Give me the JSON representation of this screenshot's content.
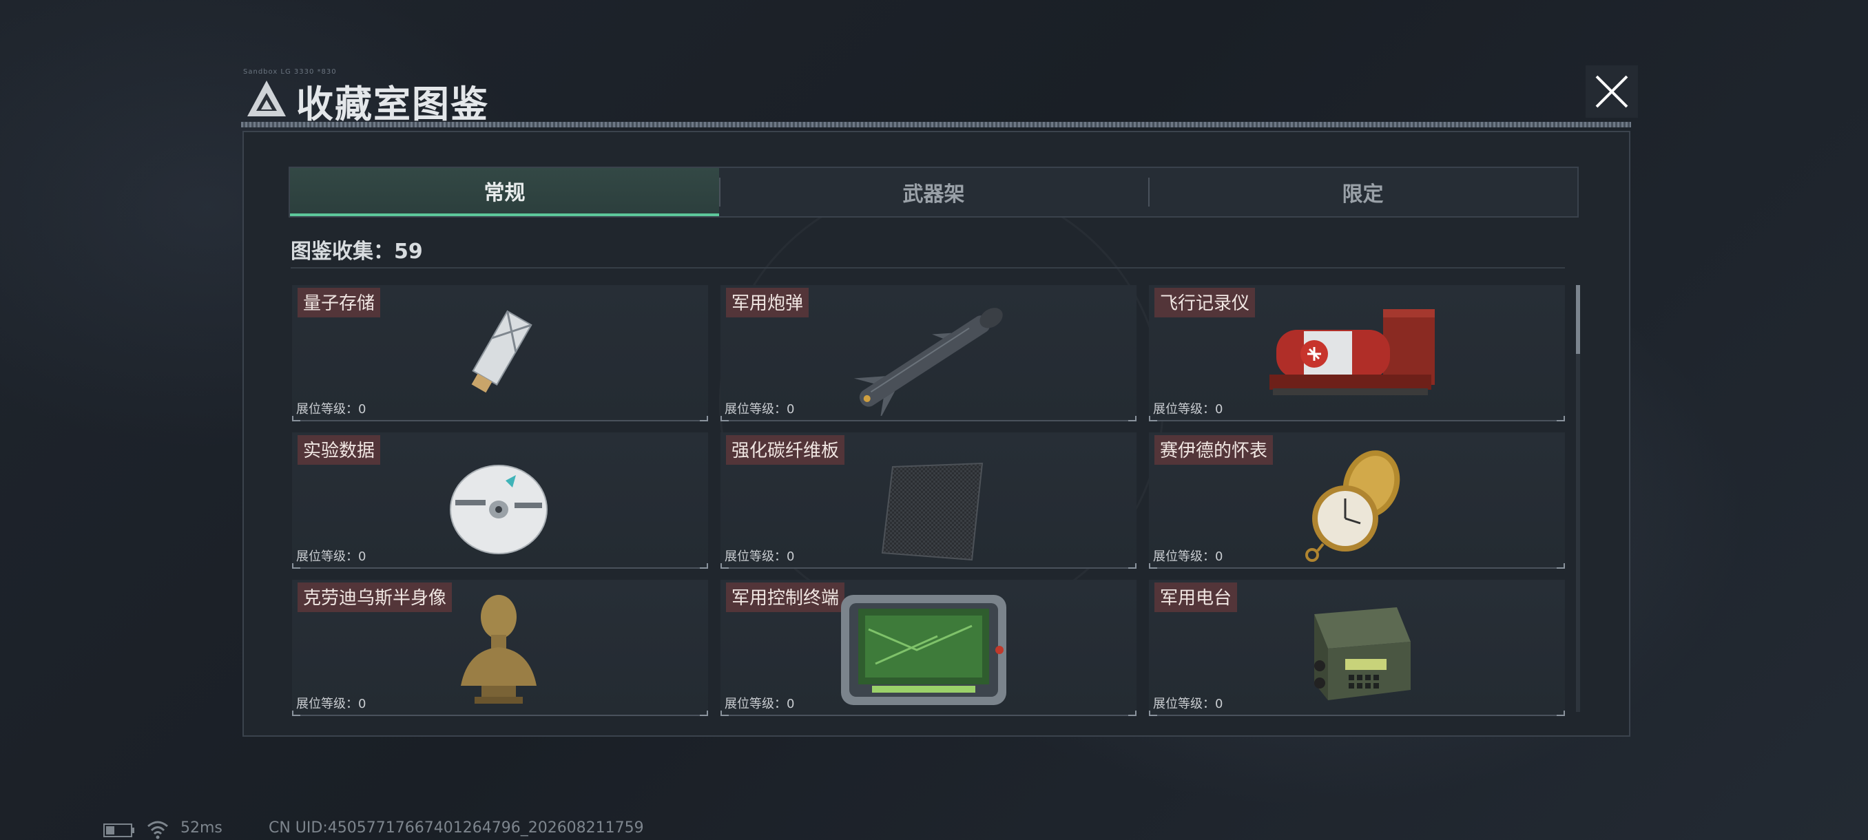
{
  "header": {
    "tiny_caption": "Sandbox LG 3330 *830",
    "title": "收藏室图鉴"
  },
  "tabs": [
    {
      "label": "常规",
      "active": true
    },
    {
      "label": "武器架",
      "active": false
    },
    {
      "label": "限定",
      "active": false
    }
  ],
  "collection": {
    "label": "图鉴收集：59"
  },
  "items": [
    {
      "name": "量子存储",
      "level": "展位等级：0",
      "icon": "usb-drive-icon"
    },
    {
      "name": "军用炮弹",
      "level": "展位等级：0",
      "icon": "missile-icon"
    },
    {
      "name": "飞行记录仪",
      "level": "展位等级：0",
      "icon": "flight-recorder-icon"
    },
    {
      "name": "实验数据",
      "level": "展位等级：0",
      "icon": "disc-icon"
    },
    {
      "name": "强化碳纤维板",
      "level": "展位等级：0",
      "icon": "carbon-plate-icon"
    },
    {
      "name": "赛伊德的怀表",
      "level": "展位等级：0",
      "icon": "pocket-watch-icon"
    },
    {
      "name": "克劳迪乌斯半身像",
      "level": "展位等级：0",
      "icon": "bust-icon"
    },
    {
      "name": "军用控制终端",
      "level": "展位等级：0",
      "icon": "terminal-icon"
    },
    {
      "name": "军用电台",
      "level": "展位等级：0",
      "icon": "radio-icon"
    }
  ],
  "status_bar": {
    "ping": "52ms",
    "uid": "CN UID:450577176674012647​96_202608211759"
  },
  "colors": {
    "accent": "#5dc79a",
    "name_tag_bg": "#783c3c"
  }
}
